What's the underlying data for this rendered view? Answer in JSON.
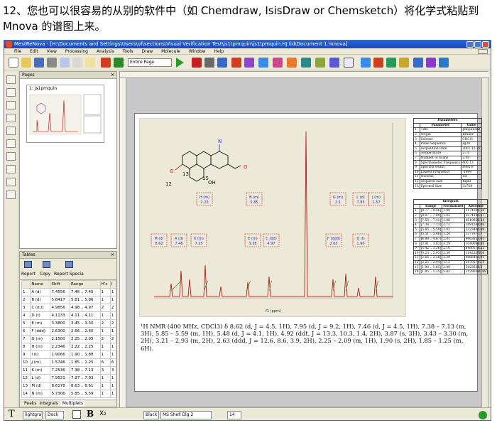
{
  "intro": {
    "text": "12、您也可以很容易的从别的软件中（如 Chemdraw, IsisDraw or Chemsketch）将化学式粘贴到 Mnova 的谱图上来。"
  },
  "window": {
    "title": "MestReNova - [H:\\Documents and Settings\\Users\\of\\sections\\Visual Verification Test\\js1\\pmquin\\js1\\pmquin.HJ.lid\\Document 1.mnova]"
  },
  "menu": [
    "File",
    "Edit",
    "View",
    "Processing",
    "Analysis",
    "Tools",
    "Draw",
    "Molecule",
    "Window",
    "Help"
  ],
  "toolbar": {
    "page_select": "Entire Page"
  },
  "pages_panel": {
    "title": "Pages",
    "page_label": "1: js1pmquin"
  },
  "tables_panel": {
    "title": "Tables",
    "tools": [
      "Report",
      "Copy",
      "Report Specia"
    ],
    "columns": [
      "",
      "Name",
      "Shift",
      "Range",
      "H's",
      "I"
    ],
    "rows": [
      [
        "1",
        "A (d)",
        "7.4556",
        "7.46 .. 7.45",
        "1",
        "1"
      ],
      [
        "2",
        "B (d)",
        "5.8417",
        "5.81 .. 5.86",
        "1",
        "1"
      ],
      [
        "3",
        "C (d,t)",
        "4.9856",
        "4.98 .. 4.97",
        "2",
        "2"
      ],
      [
        "4",
        "D (t)",
        "4.1133",
        "4.11 .. 4.11",
        "1",
        "1"
      ],
      [
        "5",
        "E (m)",
        "3.3800",
        "3.45 .. 3.30",
        "2",
        "2"
      ],
      [
        "6",
        "F (ddd)",
        "2.6300",
        "2.66 .. 2.60",
        "1",
        "1"
      ],
      [
        "7",
        "G (m)",
        "2.1500",
        "2.25 .. 2.05",
        "2",
        "2"
      ],
      [
        "8",
        "H (m)",
        "2.2346",
        "2.22 .. 2.25",
        "1",
        "1"
      ],
      [
        "9",
        "I (t)",
        "1.9066",
        "1.90 .. 1.88",
        "1",
        "1"
      ],
      [
        "10",
        "J (m)",
        "1.5746",
        "1.85 .. 1.25",
        "6",
        "6"
      ],
      [
        "11",
        "K (m)",
        "7.2536",
        "7.38 .. 7.13",
        "3",
        "3"
      ],
      [
        "12",
        "L (d)",
        "7.9521",
        "7.97 .. 7.93",
        "1",
        "1"
      ],
      [
        "13",
        "M (d)",
        "8.6178",
        "8.63 .. 8.61",
        "1",
        "1"
      ],
      [
        "14",
        "N (m)",
        "5.7306",
        "5.85 .. 5.59",
        "1",
        "1"
      ]
    ],
    "tabs": [
      "Peaks",
      "Integrals",
      "Multiplets"
    ]
  },
  "spectrum": {
    "multiplet_boxes": [
      "H (m)\n2.23",
      "B (m)\n5.85",
      "G (m)\n2.1",
      "L (d)\n7.95",
      "J (m)\n1.57",
      "M (d)\n8.62",
      "A (d)\n7.46",
      "K (m)\n7.25",
      "E (m)\n3.38",
      "C (dd)\n4.97",
      "F (ddd)\n2.63",
      "D (t)\n1.90"
    ],
    "molecule_labels": [
      "O",
      "OH",
      "O",
      "N",
      "12",
      "13",
      "15"
    ]
  },
  "parameters": {
    "title": "Parameters",
    "header": [
      "",
      "Parameter",
      "Value"
    ],
    "rows": [
      [
        "1",
        "Title",
        "pmquinone"
      ],
      [
        "2",
        "Origin",
        "Bruker"
      ],
      [
        "3",
        "Solvent",
        "CDCl3"
      ],
      [
        "4",
        "Pulse Sequence",
        "zg30"
      ],
      [
        "5",
        "Acquisition Date",
        "2007-12-22"
      ],
      [
        "6",
        "Temperature",
        "27.0"
      ],
      [
        "7",
        "Number of Scans",
        "2.00"
      ],
      [
        "8",
        "Spectrometer Frequency",
        "400.13"
      ],
      [
        "9",
        "Spectral Width",
        "8992.8"
      ],
      [
        "10",
        "Lowest Frequency",
        "-1499"
      ],
      [
        "11",
        "Nucleus",
        "1H"
      ],
      [
        "12",
        "Acquired Size",
        "Right"
      ],
      [
        "13",
        "Spectral Size",
        "32768"
      ]
    ]
  },
  "integrals": {
    "title": "Integrals",
    "header": [
      "",
      "Range",
      "Normalized",
      "Absolute"
    ],
    "rows": [
      [
        "1",
        "[8.77 .. 8.46]",
        "1.00",
        "5174300.18"
      ],
      [
        "2",
        "[8.07 .. 7.88]",
        "1.02",
        "5274145.57"
      ],
      [
        "3",
        "[7.50 .. 7.41]",
        "1.08",
        "4519056.34"
      ],
      [
        "4",
        "[7.38 .. 7.13]",
        "2.72",
        "1691508.06"
      ],
      [
        "5",
        "[5.85 .. 5.59]",
        "1.02",
        "5323406.48"
      ],
      [
        "6",
        "[5.51 .. 5.46]",
        "1.24",
        "1377877.7"
      ],
      [
        "7",
        "[4.98 .. 4.87]",
        "2.01",
        "9463853.41"
      ],
      [
        "8",
        "[3.91 .. 3.82]",
        "3.29",
        "1049084.88"
      ],
      [
        "9",
        "[3.42 .. 3.36]",
        "2.16",
        "8460578.52"
      ],
      [
        "10",
        "[3.23 .. 2.93]",
        "2.30",
        "11422278.6"
      ],
      [
        "11",
        "[2.66 .. 2.58]",
        "2.29",
        "9866403.91"
      ],
      [
        "12",
        "[2.25 .. 2.04]",
        "1.12",
        "54705747.4"
      ],
      [
        "13",
        "[1.90 .. 1.85]",
        "2.08",
        "5423638.5"
      ],
      [
        "14",
        "[1.85 .. 1.25]",
        "5.82",
        "31290340.68"
      ]
    ]
  },
  "caption": {
    "text": "¹H NMR (400 MHz, CDCl3) δ 8.62 (d, J = 4.5, 1H), 7.95 (d, J = 9.2, 1H), 7.46 (d, J = 4.5, 1H), 7.38 – 7.13 (m, 3H), 5.85 – 5.59 (m, 1H), 5.48 (d, J = 4.1, 1H), 4.92 (ddt, J = 13.3, 10.3, 1.4, 2H), 3.87 (s, 3H), 3.43 – 3.30 (m, 2H), 3.21 – 2.93 (m, 2H), 2.63 (ddd, J = 12.6, 8.6, 3.9, 2H), 2.25 – 2.09 (m, 1H), 1.90 (s, 2H), 1.85 – 1.25 (m, 6H)."
  },
  "axis": {
    "xlabel": "f1 (ppm)"
  },
  "bottom": {
    "font_style": "lightgray",
    "font_size": "Dock",
    "color_label": "Black",
    "font_name": "MS Shell Dlg 2",
    "size_value": "14"
  },
  "colors": {
    "title_blue": "#1848b8",
    "spectrum_red": "#b00000",
    "integral_green": "#2a8a2a",
    "box_red": "#c82020"
  }
}
